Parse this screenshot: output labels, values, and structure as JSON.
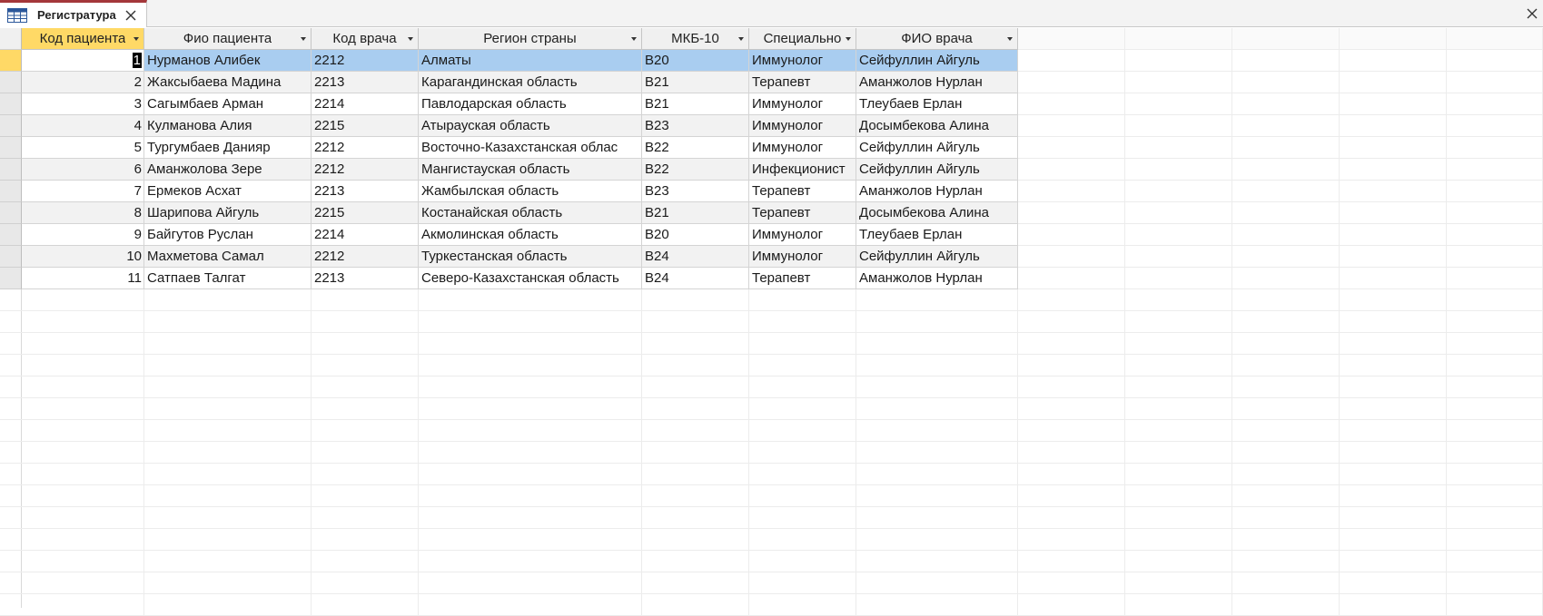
{
  "tab": {
    "title": "Регистратура",
    "icon": "table-icon",
    "accent": "#a4373a"
  },
  "table": {
    "columns": [
      {
        "label": "Код пациента",
        "active": true
      },
      {
        "label": "Фио пациента"
      },
      {
        "label": "Код врача"
      },
      {
        "label": "Регион страны"
      },
      {
        "label": "МКБ-10"
      },
      {
        "label": "Специально"
      },
      {
        "label": "ФИО врача"
      }
    ],
    "rows": [
      [
        "1",
        "Нурманов Алибек",
        "2212",
        "Алматы",
        "B20",
        "Иммунолог",
        "Сейфуллин Айгуль"
      ],
      [
        "2",
        "Жаксыбаева Мадина",
        "2213",
        "Карагандинская область",
        "B21",
        "Терапевт",
        "Аманжолов Нурлан"
      ],
      [
        "3",
        "Сагымбаев Арман",
        "2214",
        "Павлодарская область",
        "B21",
        "Иммунолог",
        "Тлеубаев Ерлан"
      ],
      [
        "4",
        "Кулманова Алия",
        "2215",
        "Атырауская область",
        "B23",
        "Иммунолог",
        "Досымбекова Алина"
      ],
      [
        "5",
        "Тургумбаев Данияр",
        "2212",
        "Восточно-Казахстанская облас",
        "B22",
        "Иммунолог",
        "Сейфуллин Айгуль"
      ],
      [
        "6",
        "Аманжолова Зере",
        "2212",
        "Мангистауская область",
        "B22",
        "Инфекционист",
        "Сейфуллин Айгуль"
      ],
      [
        "7",
        "Ермеков Асхат",
        "2213",
        "Жамбылская область",
        "B23",
        "Терапевт",
        "Аманжолов Нурлан"
      ],
      [
        "8",
        "Шарипова Айгуль",
        "2215",
        "Костанайская область",
        "B21",
        "Терапевт",
        "Досымбекова Алина"
      ],
      [
        "9",
        "Байгутов Руслан",
        "2214",
        "Акмолинская область",
        "B20",
        "Иммунолог",
        "Тлеубаев Ерлан"
      ],
      [
        "10",
        "Махметова Самал",
        "2212",
        "Туркестанская область",
        "B24",
        "Иммунолог",
        "Сейфуллин Айгуль"
      ],
      [
        "11",
        "Сатпаев Талгат",
        "2213",
        "Северо-Казахстанская область",
        "B24",
        "Терапевт",
        "Аманжолов Нурлан"
      ]
    ],
    "selected_row": 0,
    "colors": {
      "selected_row": "#a9cdf0",
      "active_header": "#ffd966",
      "alt_row": "#f2f2f2"
    }
  }
}
